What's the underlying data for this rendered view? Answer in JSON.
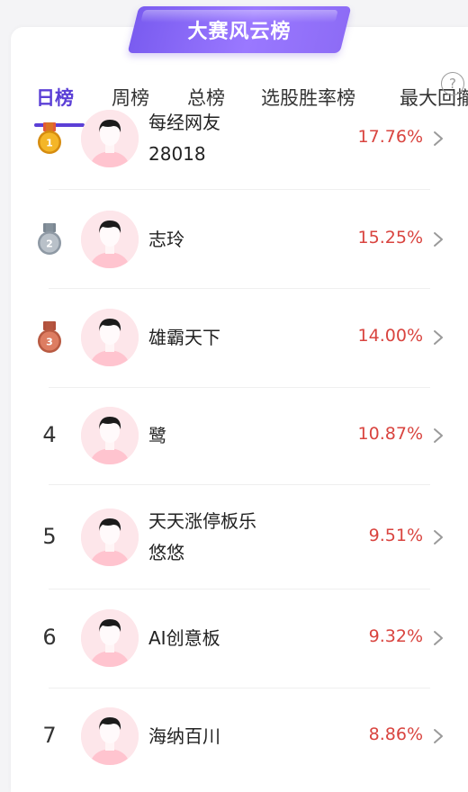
{
  "banner": {
    "title": "大赛风云榜"
  },
  "help_icon": "?",
  "tabs": [
    {
      "label": "日榜",
      "active": true
    },
    {
      "label": "周榜"
    },
    {
      "label": "总榜"
    },
    {
      "label": "选股胜率榜"
    },
    {
      "label": "最大回撤"
    }
  ],
  "colors": {
    "accent": "#5b3fd6",
    "percent": "#d9443f",
    "gold": "#f0b020",
    "silver": "#a9b1ba",
    "bronze": "#cf6f58",
    "avatar_bg": "#fde6ea"
  },
  "leaderboard": [
    {
      "rank": "1",
      "medal": "gold",
      "name_lines": [
        "每经网友",
        "28018"
      ],
      "percent": "17.76%"
    },
    {
      "rank": "2",
      "medal": "silver",
      "name_lines": [
        "志玲"
      ],
      "percent": "15.25%"
    },
    {
      "rank": "3",
      "medal": "bronze",
      "name_lines": [
        "雄霸天下"
      ],
      "percent": "14.00%"
    },
    {
      "rank": "4",
      "name_lines": [
        "鹭"
      ],
      "percent": "10.87%"
    },
    {
      "rank": "5",
      "name_lines": [
        "天天涨停板乐",
        "悠悠"
      ],
      "percent": "9.51%"
    },
    {
      "rank": "6",
      "name_lines": [
        "AI创意板"
      ],
      "percent": "9.32%"
    },
    {
      "rank": "7",
      "name_lines": [
        "海纳百川"
      ],
      "percent": "8.86%"
    }
  ]
}
